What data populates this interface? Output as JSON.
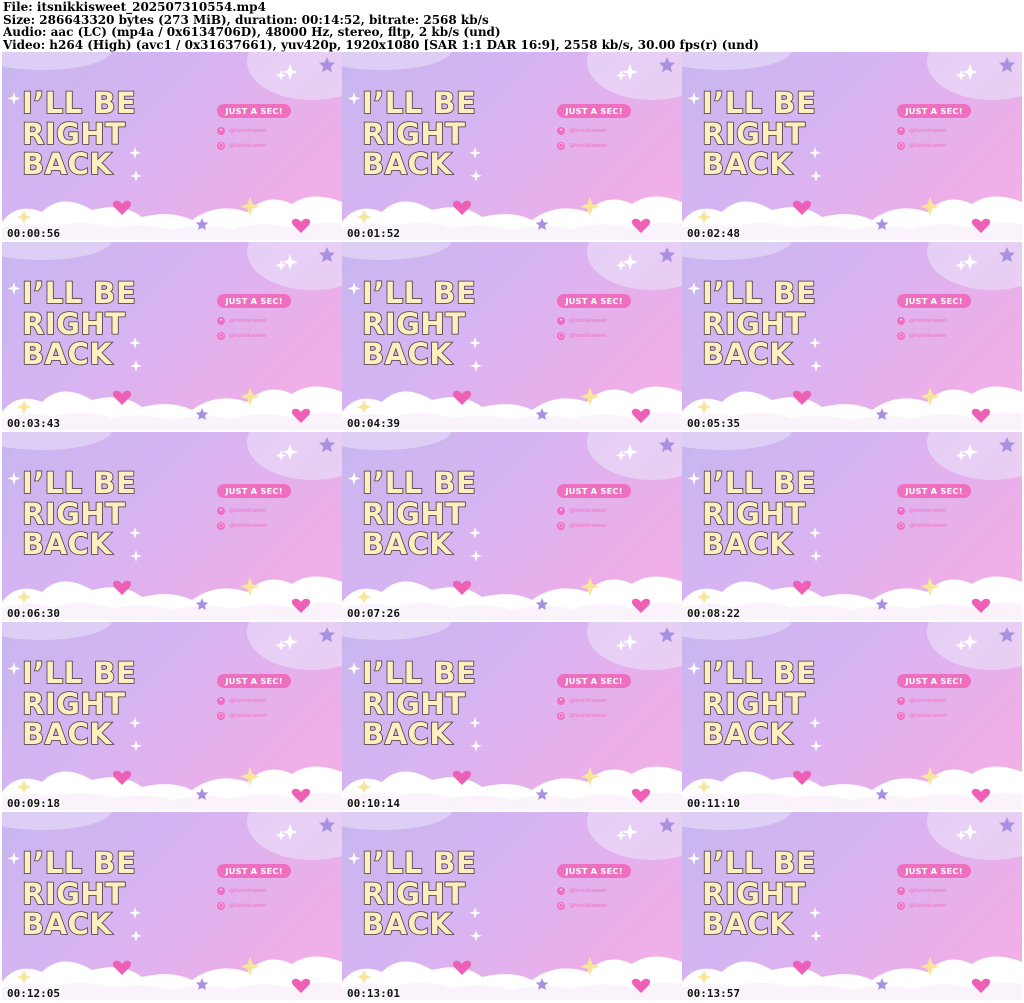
{
  "file_info": {
    "file_line": "File: itsnikkisweet_202507310554.mp4",
    "size_line": "Size: 286643320 bytes (273 MiB), duration: 00:14:52, bitrate: 2568 kb/s",
    "audio_line": "Audio: aac (LC) (mp4a / 0x6134706D), 48000 Hz, stereo, fltp, 2 kb/s (und)",
    "video_line": "Video: h264 (High) (avc1 / 0x31637661), yuv420p, 1920x1080 [SAR 1:1 DAR 16:9], 2558 kb/s, 30.00 fps(r) (und)"
  },
  "frame": {
    "title_lines": [
      "I’LL BE",
      "RIGHT",
      "BACK"
    ],
    "badge": "JUST A SEC!",
    "twitter_icon": "twitter-bird-icon",
    "instagram_icon": "instagram-icon",
    "social_handles": [
      "@itsnikkisweet",
      "@itsnikkisweet"
    ],
    "colors": {
      "title_fill": "#fdefc0",
      "title_outline": "#4a3a3a",
      "accent_pink": "#ee6fc0",
      "background_from": "#c7b6ef",
      "background_to": "#f3b2e6"
    }
  },
  "timestamps": [
    "00:00:56",
    "00:01:52",
    "00:02:48",
    "00:03:43",
    "00:04:39",
    "00:05:35",
    "00:06:30",
    "00:07:26",
    "00:08:22",
    "00:09:18",
    "00:10:14",
    "00:11:10",
    "00:12:05",
    "00:13:01",
    "00:13:57"
  ]
}
